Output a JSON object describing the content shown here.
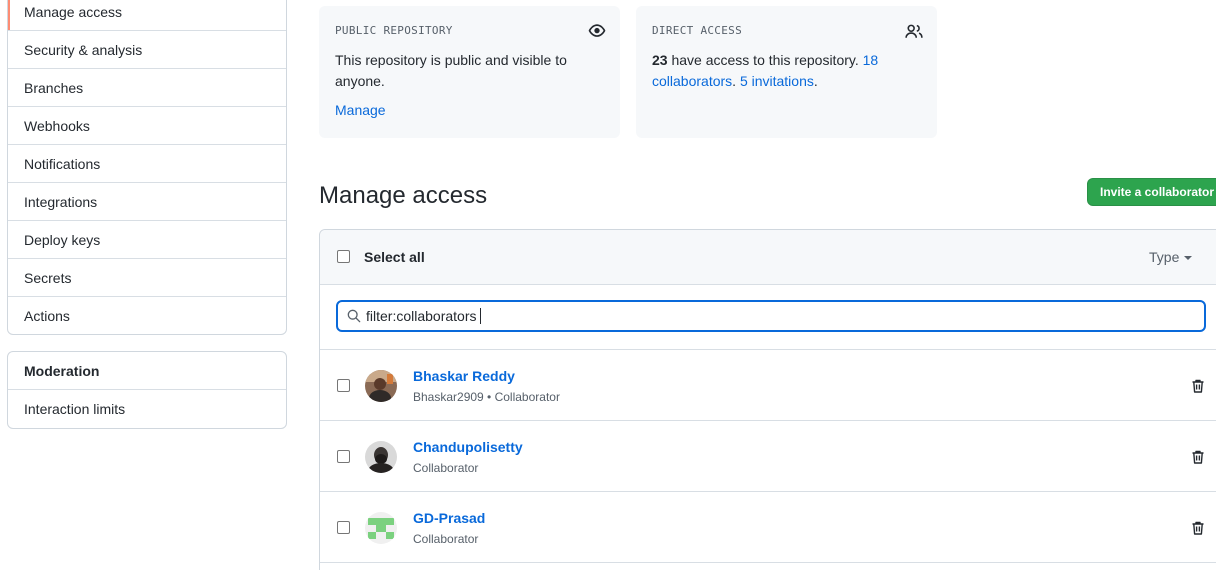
{
  "sidebar": {
    "items": [
      {
        "label": "Manage access",
        "selected": true
      },
      {
        "label": "Security & analysis"
      },
      {
        "label": "Branches"
      },
      {
        "label": "Webhooks"
      },
      {
        "label": "Notifications"
      },
      {
        "label": "Integrations"
      },
      {
        "label": "Deploy keys"
      },
      {
        "label": "Secrets"
      },
      {
        "label": "Actions"
      }
    ],
    "moderation": {
      "heading": "Moderation",
      "items": [
        {
          "label": "Interaction limits"
        }
      ]
    }
  },
  "cards": {
    "public": {
      "label": "PUBLIC REPOSITORY",
      "icon": "eye-icon",
      "text": "This repository is public and visible to anyone.",
      "link": "Manage"
    },
    "direct": {
      "label": "DIRECT ACCESS",
      "icon": "people-icon",
      "count": "23",
      "text": "have access to this repository.",
      "collaborators": "18 collaborators",
      "invitations": "5 invitations"
    }
  },
  "section": {
    "title": "Manage access",
    "invite_button": "Invite a collaborator"
  },
  "table": {
    "select_all": "Select all",
    "type_filter": "Type",
    "search": {
      "value": "filter:collaborators"
    },
    "rows": [
      {
        "name": "Bhaskar Reddy",
        "meta": "Bhaskar2909 • Collaborator",
        "avatar": "photo-avatar"
      },
      {
        "name": "Chandupolisetty",
        "meta": "Collaborator",
        "avatar": "photo-avatar"
      },
      {
        "name": "GD-Prasad",
        "meta": "Collaborator",
        "avatar": "identicon-avatar"
      }
    ]
  },
  "colors": {
    "accent": "#0969da",
    "primary_button": "#2da44e",
    "selected_indicator": "#fd8c73",
    "identicon": "#7bd17f"
  }
}
